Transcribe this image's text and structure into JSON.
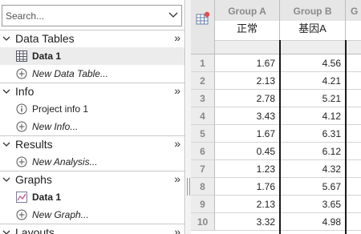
{
  "navigator": {
    "search": {
      "placeholder": "Search..."
    },
    "sections": [
      {
        "title": "Data Tables",
        "items": [
          {
            "label": "Data 1",
            "icon": "table-icon",
            "selected": true,
            "style": "bold"
          },
          {
            "label": "New Data Table...",
            "icon": "add-circle-icon",
            "style": "italic"
          }
        ]
      },
      {
        "title": "Info",
        "items": [
          {
            "label": "Project info 1",
            "icon": "info-circle-icon",
            "style": "normal"
          },
          {
            "label": "New Info...",
            "icon": "add-circle-icon",
            "style": "italic"
          }
        ]
      },
      {
        "title": "Results",
        "items": [
          {
            "label": "New Analysis...",
            "icon": "add-circle-icon",
            "style": "italic"
          }
        ]
      },
      {
        "title": "Graphs",
        "items": [
          {
            "label": "Data 1",
            "icon": "graph-icon",
            "style": "bold"
          },
          {
            "label": "New Graph...",
            "icon": "add-circle-icon",
            "style": "italic"
          }
        ]
      },
      {
        "title": "Layouts",
        "items": []
      }
    ],
    "collapse_glyph": "»"
  },
  "sheet": {
    "columns": [
      {
        "header": "Group A",
        "subheader": "正常"
      },
      {
        "header": "Group B",
        "subheader": "基因A"
      },
      {
        "header": "G",
        "subheader": ""
      }
    ],
    "rows": [
      {
        "num": "1",
        "a": "1.67",
        "b": "4.56"
      },
      {
        "num": "2",
        "a": "2.13",
        "b": "4.21"
      },
      {
        "num": "3",
        "a": "2.78",
        "b": "5.21"
      },
      {
        "num": "4",
        "a": "3.43",
        "b": "4.12"
      },
      {
        "num": "5",
        "a": "1.67",
        "b": "6.31"
      },
      {
        "num": "6",
        "a": "0.45",
        "b": "6.12"
      },
      {
        "num": "7",
        "a": "1.23",
        "b": "4.32"
      },
      {
        "num": "8",
        "a": "1.76",
        "b": "5.67"
      },
      {
        "num": "9",
        "a": "2.13",
        "b": "3.65"
      },
      {
        "num": "10",
        "a": "3.32",
        "b": "4.98"
      }
    ]
  },
  "colors": {
    "selected_row": "#ececec",
    "header_bg": "#e6e6e6",
    "header_text": "#8a8a8a",
    "corner_badge": "#e05050"
  }
}
